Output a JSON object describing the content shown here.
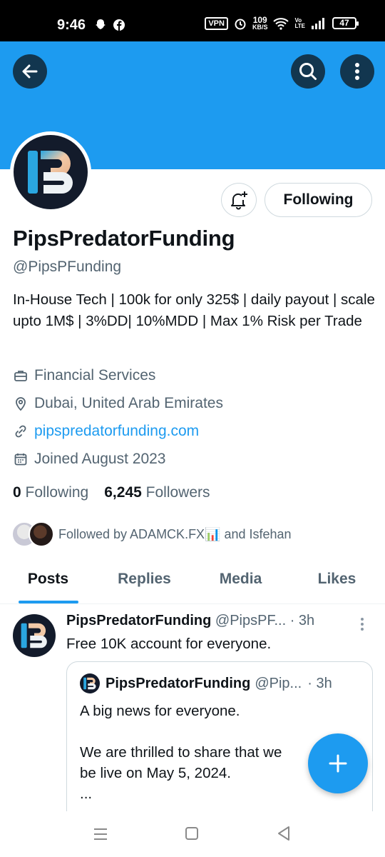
{
  "status_bar": {
    "time": "9:46",
    "vpn": "VPN",
    "speed_value": "109",
    "speed_unit": "KB/S",
    "lte_top": "Vo",
    "lte_bottom": "LTE",
    "battery": "47"
  },
  "header": {
    "back_icon": "arrow-left-icon",
    "search_icon": "search-icon",
    "more_icon": "more-vertical-icon",
    "banner_color": "#1d9bf0"
  },
  "profile": {
    "display_name": "PipsPredatorFunding",
    "handle": "@PipsPFunding",
    "bio": "In-House Tech | 100k for only 325$ | daily payout | scale upto 1M$ | 3%DD|  10%MDD | Max 1% Risk per Trade",
    "category": "Financial Services",
    "location": "Dubai, United Arab Emirates",
    "website": "pipspredatorfunding.com",
    "joined": "Joined August 2023",
    "following_count": "0",
    "following_label": "Following",
    "followers_count": "6,245",
    "followers_label": "Followers",
    "followed_by": "Followed by ADAMCK.FX📊 and Isfehan",
    "follow_button": "Following"
  },
  "tabs": [
    "Posts",
    "Replies",
    "Media",
    "Likes"
  ],
  "post": {
    "author": "PipsPredatorFunding",
    "handle": "@PipsPF...",
    "time": "· 3h",
    "text": "Free 10K account for everyone.",
    "quote": {
      "author": "PipsPredatorFunding",
      "handle": "@Pip...",
      "time": "· 3h",
      "line1": "A big news for everyone.",
      "line2": "We are thrilled to share that we",
      "line3": "be live on May 5, 2024.",
      "line4": "..."
    }
  },
  "colors": {
    "accent": "#1d9bf0",
    "text_primary": "#0f1419",
    "text_secondary": "#536471"
  }
}
